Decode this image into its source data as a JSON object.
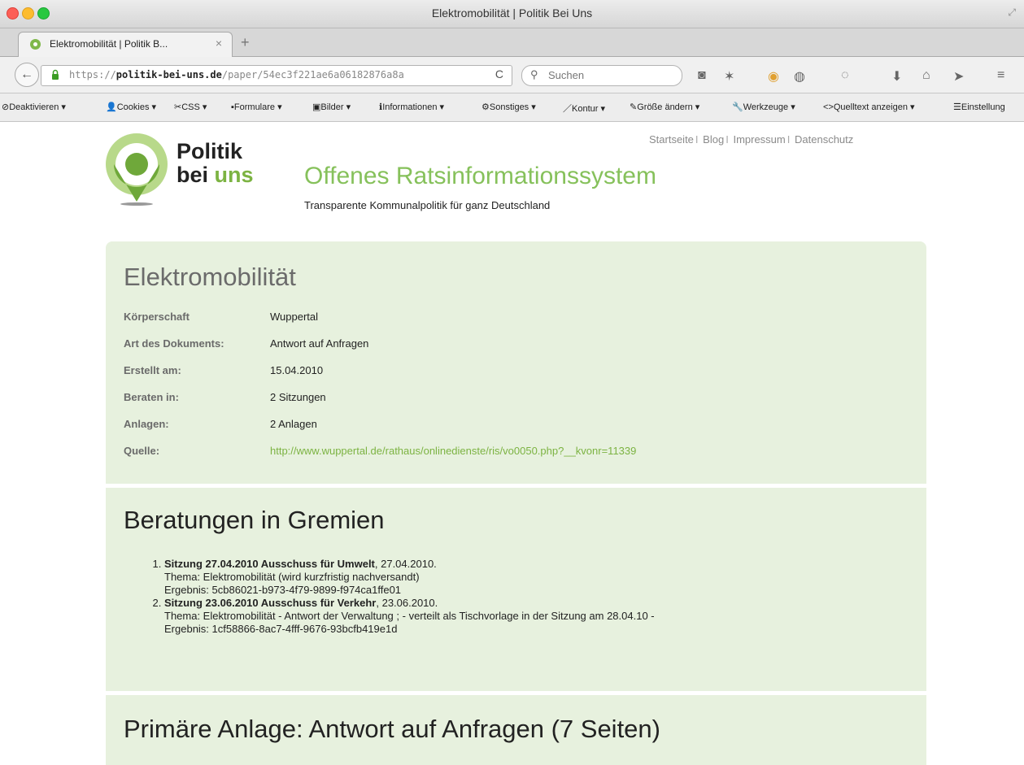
{
  "window": {
    "title": "Elektromobilität | Politik Bei Uns"
  },
  "tab": {
    "title": "Elektromobilität | Politik B...",
    "close": "×",
    "new_tab": "+"
  },
  "nav": {
    "url_scheme": "https://",
    "url_host": "politik-bei-uns.de",
    "url_path": "/paper/54ec3f221ae6a06182876a8a",
    "search_placeholder": "Suchen"
  },
  "webdev_toolbar": [
    {
      "icon": "⊘",
      "label": "Deaktivieren"
    },
    {
      "icon": "👤",
      "label": "Cookies"
    },
    {
      "icon": "✂",
      "label": "CSS"
    },
    {
      "icon": "▪",
      "label": "Formulare"
    },
    {
      "icon": "▣",
      "label": "Bilder"
    },
    {
      "icon": "ℹ",
      "label": "Informationen"
    },
    {
      "icon": "⚙",
      "label": "Sonstiges"
    },
    {
      "icon": "／",
      "label": "Kontur"
    },
    {
      "icon": "✎",
      "label": "Größe ändern"
    },
    {
      "icon": "🔧",
      "label": "Werkzeuge"
    },
    {
      "icon": "<>",
      "label": "Quelltext anzeigen"
    },
    {
      "icon": "☰",
      "label": "Einstellung"
    }
  ],
  "header": {
    "links": [
      "Startseite",
      "Blog",
      "Impressum",
      "Datenschutz"
    ],
    "logo_line1": "Politik",
    "logo_line2a": "bei ",
    "logo_line2b": "uns",
    "site_title": "Offenes Ratsinformationssystem",
    "site_subtitle": "Transparente Kommunalpolitik für ganz Deutschland"
  },
  "document": {
    "title": "Elektromobilität",
    "meta": [
      {
        "label": "Körperschaft",
        "value": "Wuppertal"
      },
      {
        "label": "Art des Dokuments:",
        "value": "Antwort auf Anfragen"
      },
      {
        "label": "Erstellt am:",
        "value": "15.04.2010"
      },
      {
        "label": "Beraten in:",
        "value": "2 Sitzungen"
      },
      {
        "label": "Anlagen:",
        "value": "2 Anlagen"
      },
      {
        "label": "Quelle:",
        "value": "http://www.wuppertal.de/rathaus/onlinedienste/ris/vo0050.php?__kvonr=11339"
      }
    ]
  },
  "consultations": {
    "heading": "Beratungen in Gremien",
    "items": [
      {
        "title": "Sitzung 27.04.2010 Ausschuss für Umwelt",
        "date": ", 27.04.2010.",
        "topic": "Thema: Elektromobilität (wird kurzfristig nachversandt)",
        "result": "Ergebnis: 5cb86021-b973-4f79-9899-f974ca1ffe01"
      },
      {
        "title": "Sitzung 23.06.2010 Ausschuss für Verkehr",
        "date": ", 23.06.2010.",
        "topic": "Thema: Elektromobilität - Antwort der Verwaltung ; - verteilt als Tischvorlage in der Sitzung am 28.04.10 -",
        "result": "Ergebnis: 1cf58866-8ac7-4fff-9676-93bcfb419e1d"
      }
    ]
  },
  "attachment": {
    "heading": "Primäre Anlage: Antwort auf Anfragen (7 Seiten)"
  },
  "colors": {
    "accent_green": "#7cb342",
    "box_bg": "#e7f1de"
  }
}
